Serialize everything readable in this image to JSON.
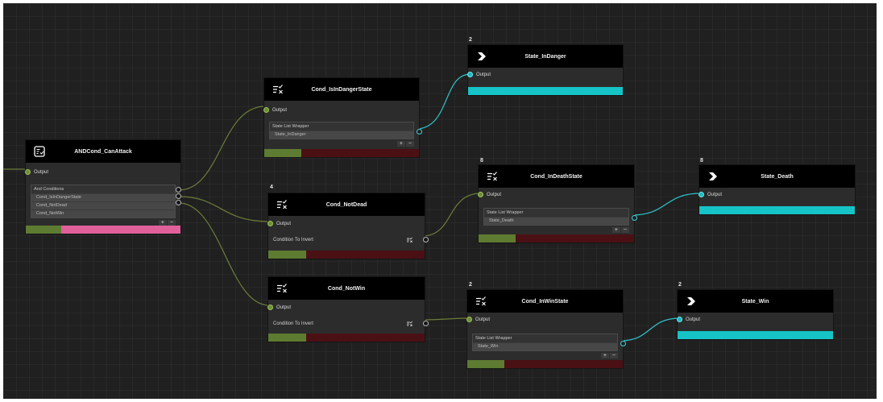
{
  "colors": {
    "wire_green": "#6b7d3a",
    "wire_cyan": "#2ec4cc",
    "bar_green": "#5e7b32",
    "bar_red": "#4a1014",
    "bar_pink": "#e0609a",
    "bar_cyan": "#16c3c6"
  },
  "icons": {
    "and": "checklist-icon",
    "cond": "condition-list-icon",
    "state": "chevron-right-icon"
  },
  "nodes": {
    "and_can_attack": {
      "title": "ANDCond_CanAttack",
      "output_label": "Output",
      "list_header": "And Conditions",
      "items": [
        "Cond_IsInDangerState",
        "Cond_NotDead",
        "Cond_NotWin"
      ],
      "plus": "+",
      "minus": "−"
    },
    "is_in_danger": {
      "title": "Cond_IsInDangerState",
      "output_label": "Output",
      "list_header": "State List Wrapper",
      "items": [
        "State_InDanger"
      ],
      "plus": "+",
      "minus": "−"
    },
    "not_dead": {
      "badge": "4",
      "title": "Cond_NotDead",
      "output_label": "Output",
      "field_label": "Condition To Invert"
    },
    "not_win": {
      "title": "Cond_NotWin",
      "output_label": "Output",
      "field_label": "Condition To Invert"
    },
    "in_danger": {
      "badge": "2",
      "title": "State_InDanger",
      "output_label": "Output"
    },
    "in_death": {
      "badge": "8",
      "title": "Cond_InDeathState",
      "output_label": "Output",
      "list_header": "State List Wrapper",
      "items": [
        "State_Death"
      ],
      "plus": "+",
      "minus": "−"
    },
    "death": {
      "badge": "8",
      "title": "State_Death",
      "output_label": "Output"
    },
    "in_win": {
      "badge": "2",
      "title": "Cond_InWinState",
      "output_label": "Output",
      "list_header": "State List Wrapper",
      "items": [
        "State_Win"
      ],
      "plus": "+",
      "minus": "−"
    },
    "win": {
      "badge": "2",
      "title": "State_Win",
      "output_label": "Output"
    }
  }
}
